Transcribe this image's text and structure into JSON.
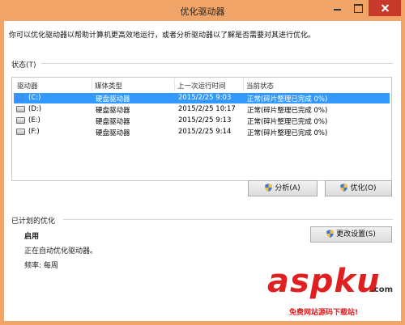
{
  "window": {
    "title": "优化驱动器",
    "accent_color": "#f0a468",
    "close_color": "#c7392b"
  },
  "intro_text": "你可以优化驱动器以帮助计算机更高效地运行，或者分析驱动器以了解是否需要对其进行优化。",
  "status": {
    "label": "状态(T)",
    "columns": [
      "驱动器",
      "媒体类型",
      "上一次运行时间",
      "当前状态"
    ],
    "rows": [
      {
        "drive": "(C:)",
        "icon": "windows-drive-icon",
        "media": "硬盘驱动器",
        "last_run": "2015/2/25 9:03",
        "state": "正常(碎片整理已完成 0%)",
        "selected": true
      },
      {
        "drive": "(D:)",
        "icon": "hard-drive-icon",
        "media": "硬盘驱动器",
        "last_run": "2015/2/25 10:17",
        "state": "正常(碎片整理已完成 0%)",
        "selected": false
      },
      {
        "drive": "(E:)",
        "icon": "hard-drive-icon",
        "media": "硬盘驱动器",
        "last_run": "2015/2/25 9:13",
        "state": "正常(碎片整理已完成 0%)",
        "selected": false
      },
      {
        "drive": "(F:)",
        "icon": "hard-drive-icon",
        "media": "硬盘驱动器",
        "last_run": "2015/2/25 9:14",
        "state": "正常(碎片整理已完成 0%)",
        "selected": false
      }
    ],
    "selection_color": "#3399ff"
  },
  "buttons": {
    "analyze": "分析(A)",
    "optimize": "优化(O)",
    "change_settings": "更改设置(S)"
  },
  "scheduled": {
    "label": "已计划的优化",
    "status": "启用",
    "description": "正在自动优化驱动器。",
    "frequency": "频率: 每周"
  },
  "watermark": {
    "brand": "aspku",
    "tld": ".com",
    "tagline": "免费网站源码下载站!"
  }
}
